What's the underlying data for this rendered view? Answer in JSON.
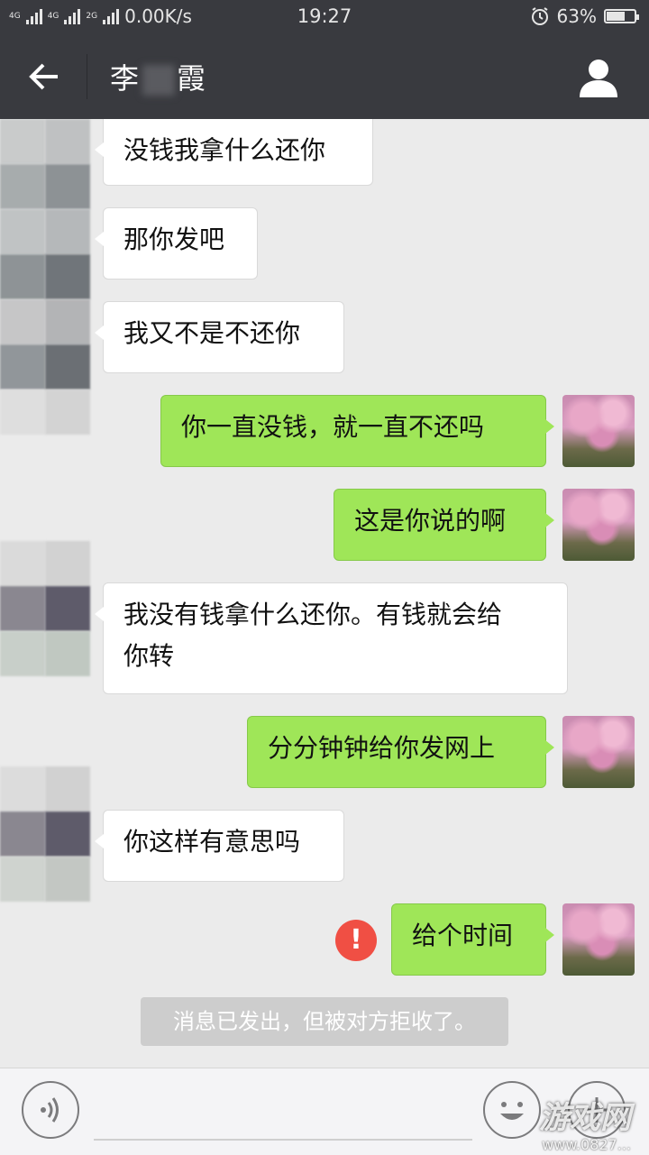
{
  "status_bar": {
    "network_left": "4G",
    "network_mid": "4G",
    "network_2g": "2G",
    "speed": "0.00K/s",
    "time": "19:27",
    "battery": "63%",
    "battery_level": 0.63
  },
  "header": {
    "contact_name_first": "李",
    "contact_name_last": "霞"
  },
  "messages": [
    {
      "side": "left",
      "text": "没钱我拿什么还你"
    },
    {
      "side": "left",
      "text": "那你发吧"
    },
    {
      "side": "left",
      "text": "我又不是不还你"
    },
    {
      "side": "right",
      "text": "你一直没钱，就一直不还吗"
    },
    {
      "side": "right",
      "text": "这是你说的啊"
    },
    {
      "side": "left",
      "text_line1": "我没有钱拿什么还你。有钱就会给",
      "text_line2": "你转"
    },
    {
      "side": "right",
      "text": "分分钟钟给你发网上"
    },
    {
      "side": "left",
      "text": "你这样有意思吗"
    },
    {
      "side": "right",
      "text": "给个时间",
      "error_mark": "!"
    }
  ],
  "system_message": "消息已发出，但被对方拒收了。",
  "watermark": {
    "main": "游戏网",
    "sub": "www.0827..."
  },
  "colors": {
    "header": "#393a3f",
    "bubble_right": "#9fe658",
    "error": "#f04f44"
  },
  "icons": [
    "back-arrow-icon",
    "profile-icon",
    "voice-icon",
    "emoji-icon",
    "plus-icon",
    "error-icon"
  ]
}
